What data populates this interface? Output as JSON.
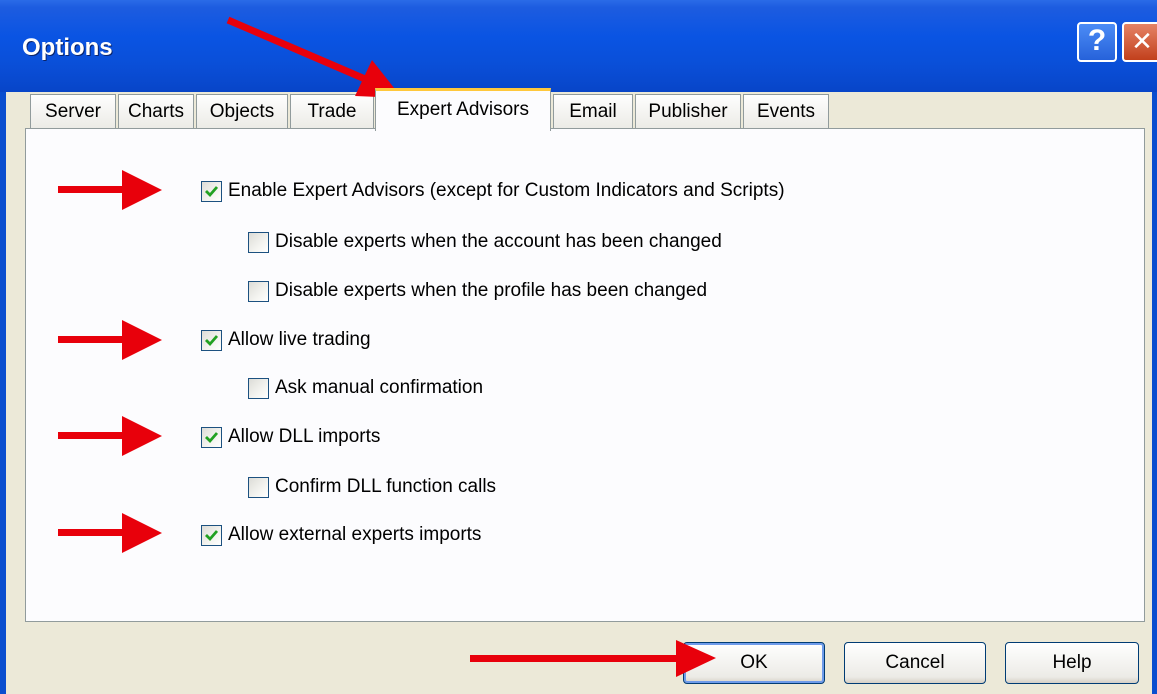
{
  "window": {
    "title": "Options",
    "help_glyph": "?",
    "close_glyph": "✕"
  },
  "tabs": [
    {
      "label": "Server"
    },
    {
      "label": "Charts"
    },
    {
      "label": "Objects"
    },
    {
      "label": "Trade"
    },
    {
      "label": "Expert Advisors",
      "active": true
    },
    {
      "label": "Email"
    },
    {
      "label": "Publisher"
    },
    {
      "label": "Events"
    }
  ],
  "options": [
    {
      "label": "Enable Expert Advisors (except for Custom Indicators and Scripts)",
      "checked": true
    },
    {
      "label": "Disable experts when the account has been changed",
      "checked": false
    },
    {
      "label": "Disable experts when the profile has been changed",
      "checked": false
    },
    {
      "label": "Allow live trading",
      "checked": true
    },
    {
      "label": "Ask manual confirmation",
      "checked": false
    },
    {
      "label": "Allow DLL imports",
      "checked": true
    },
    {
      "label": "Confirm DLL function calls",
      "checked": false
    },
    {
      "label": "Allow external experts imports",
      "checked": true
    }
  ],
  "buttons": {
    "ok": "OK",
    "cancel": "Cancel",
    "help": "Help"
  },
  "colors": {
    "annotation_arrow": "#E8000B",
    "titlebar": "#0A54E3",
    "active_tab_highlight": "#FFC83C",
    "checkmark": "#21A121"
  }
}
